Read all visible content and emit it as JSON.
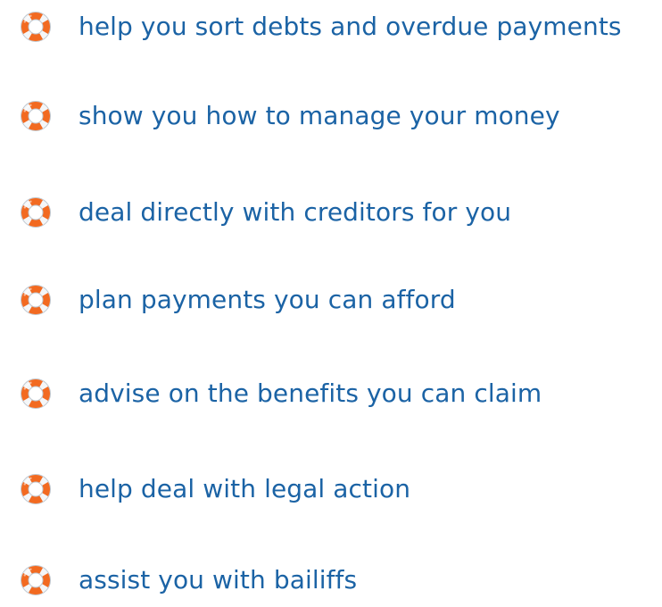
{
  "colors": {
    "text": "#1b63a5",
    "buoy_orange": "#f26a21",
    "buoy_white": "#f4f6f8",
    "buoy_edge": "#bfc7cf"
  },
  "icon": "lifebuoy-icon",
  "items": [
    {
      "label": "help you sort debts and overdue payments"
    },
    {
      "label": "show you how to manage your money"
    },
    {
      "label": "deal directly with creditors for you"
    },
    {
      "label": "plan payments you can afford"
    },
    {
      "label": "advise on the benefits you can claim"
    },
    {
      "label": "help deal with legal action"
    },
    {
      "label": "assist you with bailiffs"
    }
  ]
}
